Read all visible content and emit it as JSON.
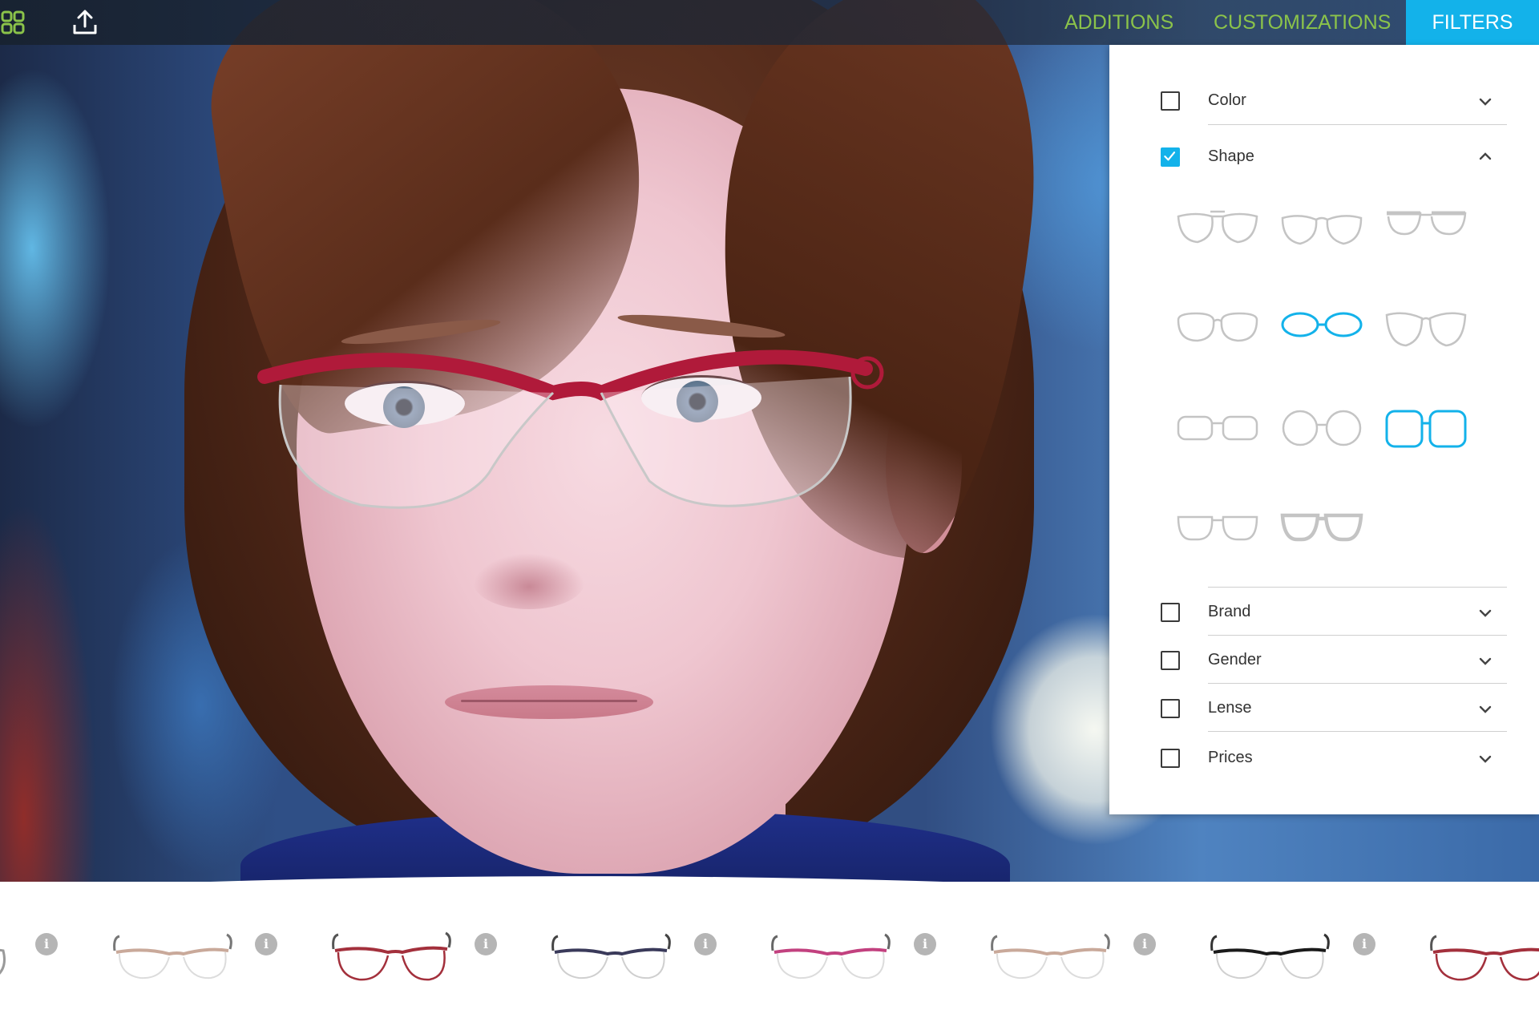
{
  "toolbar": {
    "grid_icon": "grid-icon",
    "upload_icon": "upload-icon",
    "tabs": [
      {
        "label": "ADDITIONS",
        "active": false
      },
      {
        "label": "CUSTOMIZATIONS",
        "active": false
      },
      {
        "label": "FILTERS",
        "active": true
      }
    ],
    "accent_color": "#13b2ea",
    "inactive_color": "#8bc34a"
  },
  "filters": {
    "sections": [
      {
        "label": "Color",
        "checked": false,
        "expanded": false
      },
      {
        "label": "Shape",
        "checked": true,
        "expanded": true
      },
      {
        "label": "Brand",
        "checked": false,
        "expanded": false
      },
      {
        "label": "Gender",
        "checked": false,
        "expanded": false
      },
      {
        "label": "Lense",
        "checked": false,
        "expanded": false
      },
      {
        "label": "Prices",
        "checked": false,
        "expanded": false
      }
    ],
    "shapes": [
      {
        "name": "aviator-double-bridge",
        "selected": false
      },
      {
        "name": "aviator",
        "selected": false
      },
      {
        "name": "browline",
        "selected": false
      },
      {
        "name": "pilot",
        "selected": false
      },
      {
        "name": "oval",
        "selected": true
      },
      {
        "name": "butterfly",
        "selected": false
      },
      {
        "name": "rectangle-narrow",
        "selected": false
      },
      {
        "name": "round",
        "selected": false
      },
      {
        "name": "square",
        "selected": true
      },
      {
        "name": "rectangle",
        "selected": false
      },
      {
        "name": "wayfarer",
        "selected": false
      }
    ]
  },
  "carousel": {
    "items": [
      {
        "frame": "partial-frame",
        "color": "#9a9a9a"
      },
      {
        "frame": "cat-eye-frame",
        "color": "#c9a99a"
      },
      {
        "frame": "cat-eye-frame",
        "color": "#a3303c"
      },
      {
        "frame": "cat-eye-frame",
        "color": "#3a3a5a"
      },
      {
        "frame": "cat-eye-frame",
        "color": "#c2417f"
      },
      {
        "frame": "cat-eye-frame",
        "color": "#c9a99a"
      },
      {
        "frame": "cat-eye-frame",
        "color": "#1a1a1a"
      },
      {
        "frame": "cat-eye-frame",
        "color": "#a3303c"
      }
    ],
    "info_symbol": "i"
  },
  "tryon": {
    "frame_color": "#b01a3a"
  }
}
